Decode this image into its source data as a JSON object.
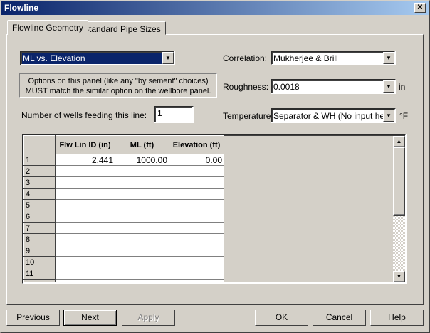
{
  "window": {
    "title": "Flowline",
    "close": "✕"
  },
  "tabs": [
    {
      "label": "Flowline Geometry",
      "active": true
    },
    {
      "label": "Standard Pipe Sizes",
      "active": false
    }
  ],
  "mode_select": {
    "value": "ML vs. Elevation"
  },
  "note": {
    "line1": "Options on this panel (like any \"by sement\" choices)",
    "line2": "MUST match the similar option on the wellbore panel."
  },
  "wells": {
    "label": "Number of wells feeding this line:",
    "value": "1"
  },
  "correlation": {
    "label": "Correlation:",
    "value": "Mukherjee & Brill"
  },
  "roughness": {
    "label": "Roughness:",
    "value": "0.0018",
    "unit": "in"
  },
  "temperature": {
    "label": "Temperature:",
    "value": "Separator & WH (No input here)",
    "unit": "°F"
  },
  "grid": {
    "columns": [
      "Flw Lin ID (in)",
      "ML (ft)",
      "Elevation (ft)"
    ],
    "rows": [
      {
        "n": "1",
        "c": [
          "2.441",
          "1000.00",
          "0.00"
        ]
      },
      {
        "n": "2",
        "c": [
          "",
          "",
          ""
        ]
      },
      {
        "n": "3",
        "c": [
          "",
          "",
          ""
        ]
      },
      {
        "n": "4",
        "c": [
          "",
          "",
          ""
        ]
      },
      {
        "n": "5",
        "c": [
          "",
          "",
          ""
        ]
      },
      {
        "n": "6",
        "c": [
          "",
          "",
          ""
        ]
      },
      {
        "n": "7",
        "c": [
          "",
          "",
          ""
        ]
      },
      {
        "n": "8",
        "c": [
          "",
          "",
          ""
        ]
      },
      {
        "n": "9",
        "c": [
          "",
          "",
          ""
        ]
      },
      {
        "n": "10",
        "c": [
          "",
          "",
          ""
        ]
      },
      {
        "n": "11",
        "c": [
          "",
          "",
          ""
        ]
      },
      {
        "n": "12",
        "c": [
          "",
          "",
          ""
        ]
      }
    ]
  },
  "buttons": {
    "previous": "Previous",
    "next": "Next",
    "apply": "Apply",
    "ok": "OK",
    "cancel": "Cancel",
    "help": "Help"
  }
}
